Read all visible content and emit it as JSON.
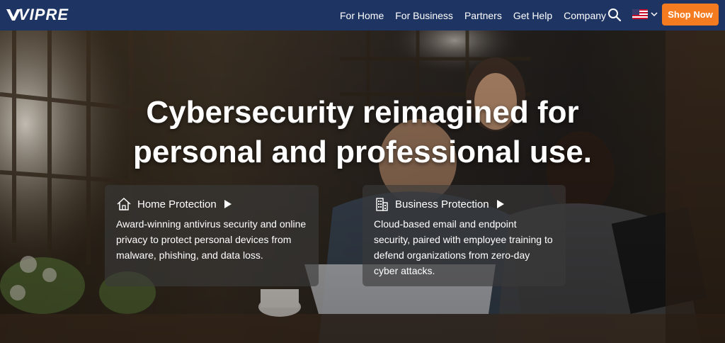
{
  "brand": {
    "logo_text": "VIPRE"
  },
  "nav": {
    "links": [
      "For Home",
      "For Business",
      "Partners",
      "Get Help",
      "Company"
    ],
    "shop_label": "Shop Now"
  },
  "icons": {
    "search": "search-icon",
    "flag": "us-flag-icon",
    "chevron": "chevron-down-icon",
    "home": "house-icon",
    "business": "building-icon",
    "arrow": "play-arrow-icon"
  },
  "colors": {
    "nav_bg": "#1e3564",
    "accent": "#f47b20",
    "card_bg": "rgba(58,58,58,0.62)",
    "text": "#ffffff"
  },
  "hero": {
    "title_line1": "Cybersecurity reimagined for",
    "title_line2": "personal and professional use.",
    "cards": [
      {
        "title": "Home Protection",
        "description": "Award-winning antivirus security and online privacy to protect personal devices from malware, phishing, and data loss."
      },
      {
        "title": "Business Protection",
        "description": "Cloud-based email and endpoint security, paired with employee training to defend organizations from zero-day cyber attacks."
      }
    ]
  }
}
